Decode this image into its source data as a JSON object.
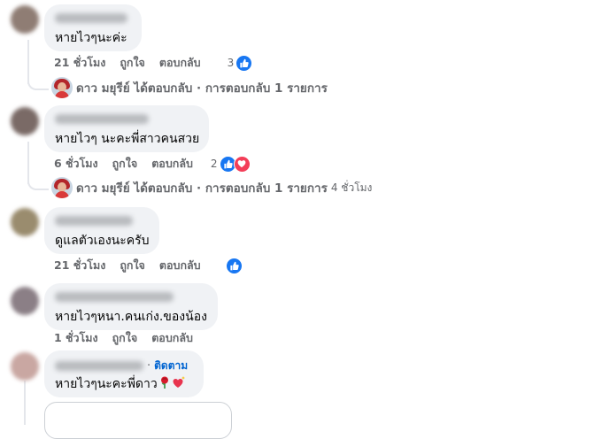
{
  "comments": [
    {
      "text": "หายไวๆนะค่ะ",
      "time": "21 ชั่วโมง",
      "like": "ถูกใจ",
      "reply": "ตอบกลับ",
      "reaction_count": "3",
      "reactions": [
        "like-icon"
      ],
      "avatar_color": "#8f7d74"
    },
    {
      "text": "หายไวๆ นะคะพี่สาวคนสวย",
      "time": "6 ชั่วโมง",
      "like": "ถูกใจ",
      "reply": "ตอบกลับ",
      "reaction_count": "2",
      "reactions": [
        "like-icon",
        "love-icon"
      ],
      "avatar_color": "#7a6a66"
    },
    {
      "text": "ดูแลตัวเองนะครับ",
      "time": "21 ชั่วโมง",
      "like": "ถูกใจ",
      "reply": "ตอบกลับ",
      "reaction_count": "",
      "reactions": [
        "like-icon"
      ],
      "avatar_color": "#9a8c6e"
    },
    {
      "text": "หายไวๆหนา.คนเก่ง.ของน้อง",
      "time": "1 ชั่วโมง",
      "like": "ถูกใจ",
      "reply": "ตอบกลับ",
      "avatar_color": "#8b7f86"
    },
    {
      "text": "หายไวๆนะคะพี่ดาว",
      "follow_sep": "·",
      "follow": "ติดตาม",
      "avatar_color": "#c9a7a2"
    }
  ],
  "reply_rows": [
    {
      "summary": "ดาว มยุรีย์ ได้ตอบกลับ · การตอบกลับ 1 รายการ",
      "time": ""
    },
    {
      "summary": "ดาว มยุรีย์ ได้ตอบกลับ · การตอบกลับ 1 รายการ",
      "time": "4 ชั่วโมง"
    }
  ],
  "colors": {
    "bubble": "#f0f2f5",
    "meta_text": "#65676b",
    "like_blue": "#1877f2",
    "love_red": "#f33e58",
    "follow_blue": "#0064d1"
  }
}
